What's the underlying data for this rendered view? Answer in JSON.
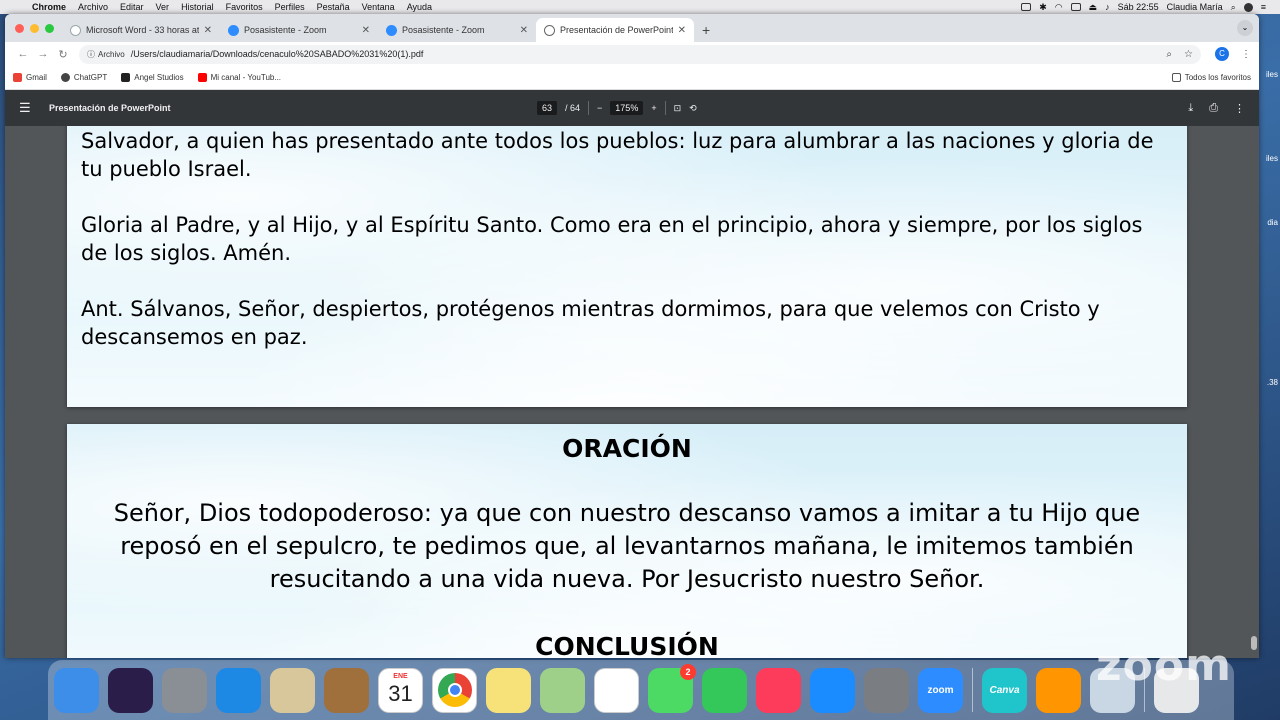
{
  "menubar": {
    "app": "Chrome",
    "menus": [
      "Archivo",
      "Editar",
      "Ver",
      "Historial",
      "Favoritos",
      "Perfiles",
      "Pestaña",
      "Ventana",
      "Ayuda"
    ],
    "datetime": "Sáb 22:55",
    "user": "Claudia María"
  },
  "tabs": [
    {
      "title": "Microsoft Word - 33 horas at...",
      "icon": "word-icon"
    },
    {
      "title": "Posasistente - Zoom",
      "icon": "zoom-icon"
    },
    {
      "title": "Posasistente - Zoom",
      "icon": "zoom-icon"
    },
    {
      "title": "Presentación de PowerPoint",
      "icon": "globe-icon"
    }
  ],
  "omnibox": {
    "chip": "Archivo",
    "url": "/Users/claudiamaria/Downloads/cenaculo%20SABADO%2031%20(1).pdf"
  },
  "profile_initial": "C",
  "bookmarks": [
    {
      "label": "Gmail",
      "color": "#ea4335"
    },
    {
      "label": "ChatGPT",
      "color": "#444444"
    },
    {
      "label": "Angel Studios",
      "color": "#222222"
    },
    {
      "label": "Mi canal - YouTub...",
      "color": "#ff0000"
    }
  ],
  "bookmarks_all": "Todos los favoritos",
  "pdf": {
    "title": "Presentación de PowerPoint",
    "page_current": "63",
    "page_total": "/ 64",
    "zoom": "175%"
  },
  "page1": {
    "para1": "Salvador, a quien has presentado ante todos los pueblos: luz para alumbrar a las naciones y gloria de tu pueblo Israel.",
    "para2": "Gloria al Padre, y al Hijo, y al Espíritu Santo. Como era en el principio, ahora y siempre, por los siglos de los siglos. Amén.",
    "para3": "Ant. Sálvanos, Señor, despiertos, protégenos mientras dormimos, para que velemos con Cristo y descansemos en paz."
  },
  "page2": {
    "heading": "ORACIÓN",
    "prayer": "Señor, Dios todopoderoso: ya que con nuestro descanso vamos a imitar a tu Hijo que reposó en el sepulcro, te pedimos que, al levantarnos mañana, le imitemos también resucitando a una vida nueva. Por Jesucristo nuestro Señor.",
    "next_heading": "CONCLUSIÓN"
  },
  "desktop_labels": [
    "iles",
    "iles",
    "dia",
    ".38"
  ],
  "dock": {
    "items": [
      {
        "name": "finder-icon",
        "color": "#3d8ee8",
        "label": ""
      },
      {
        "name": "siri-icon",
        "color": "#2a1d4a",
        "label": ""
      },
      {
        "name": "launchpad-icon",
        "color": "#8a8f96",
        "label": ""
      },
      {
        "name": "safari-icon",
        "color": "#1e88e5",
        "label": ""
      },
      {
        "name": "mail-icon",
        "color": "#d7c79a",
        "label": ""
      },
      {
        "name": "contacts-icon",
        "color": "#a0703c",
        "label": ""
      },
      {
        "name": "calendar-icon",
        "color": "#ffffff",
        "label": ""
      },
      {
        "name": "chrome-icon",
        "color": "#ffffff",
        "label": ""
      },
      {
        "name": "notes-icon",
        "color": "#f7e27a",
        "label": ""
      },
      {
        "name": "maps-icon",
        "color": "#9fd08a",
        "label": ""
      },
      {
        "name": "photos-icon",
        "color": "#ffffff",
        "label": ""
      },
      {
        "name": "messages-icon",
        "color": "#4cd964",
        "label": ""
      },
      {
        "name": "facetime-icon",
        "color": "#34c759",
        "label": ""
      },
      {
        "name": "music-icon",
        "color": "#fc3c5a",
        "label": ""
      },
      {
        "name": "appstore-icon",
        "color": "#1a8cff",
        "label": ""
      },
      {
        "name": "settings-icon",
        "color": "#7a7d82",
        "label": ""
      },
      {
        "name": "zoom-app-icon",
        "color": "#2d8cff",
        "label": "zoom"
      },
      {
        "name": "canva-icon",
        "color": "#20c4cb",
        "label": "Canva"
      },
      {
        "name": "books-icon",
        "color": "#ff9500",
        "label": ""
      },
      {
        "name": "preview-icon",
        "color": "#c9d6e3",
        "label": ""
      },
      {
        "name": "trash-icon",
        "color": "#e6e8ea",
        "label": ""
      }
    ],
    "messages_badge": "2",
    "calendar_month": "ENE",
    "calendar_day": "31"
  },
  "watermark": "zoom"
}
